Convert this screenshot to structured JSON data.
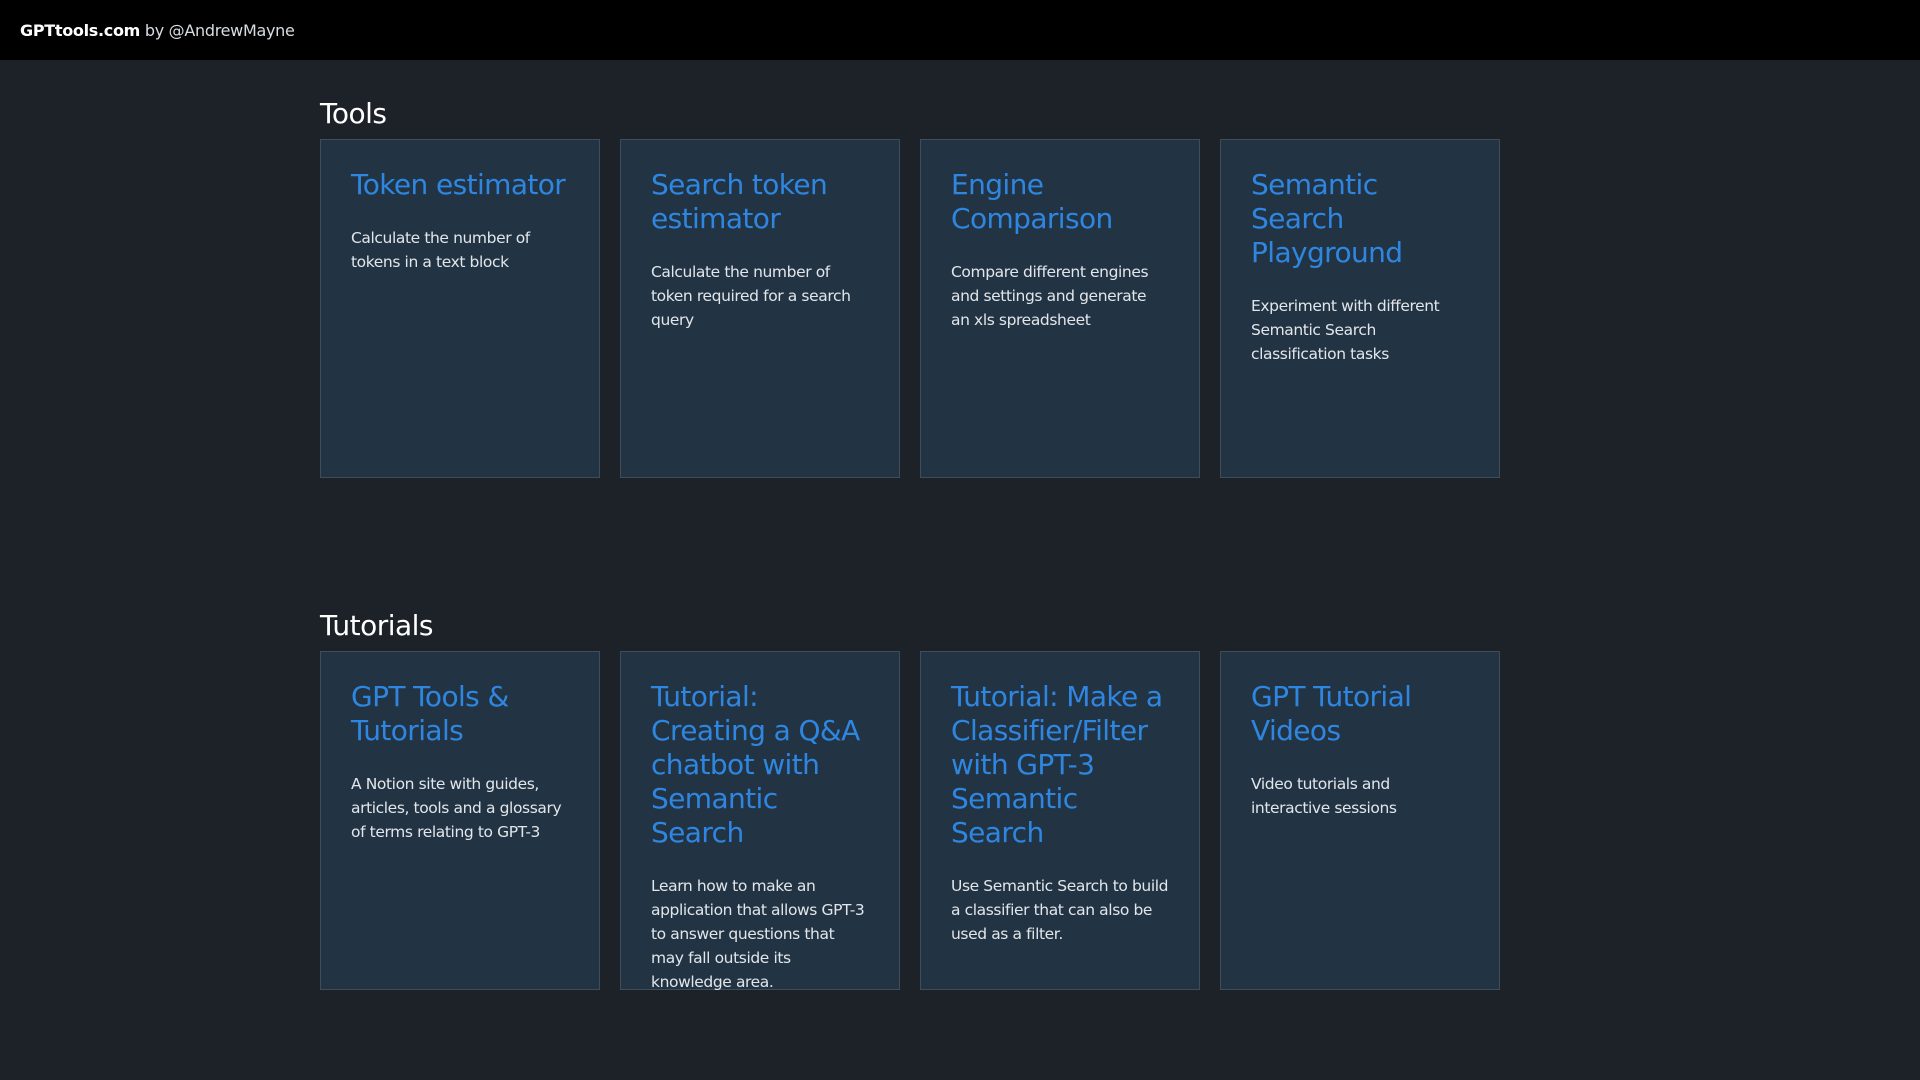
{
  "header": {
    "site": "GPTtools.com",
    "byline": "by @AndrewMayne"
  },
  "tools": {
    "title": "Tools",
    "cards": [
      {
        "title": "Token estimator",
        "description": "Calculate the number of tokens in a text block"
      },
      {
        "title": "Search token estimator",
        "description": "Calculate the number of token required for a search query"
      },
      {
        "title": "Engine Comparison",
        "description": "Compare different engines and settings and generate an xls spreadsheet"
      },
      {
        "title": "Semantic Search Playground",
        "description": "Experiment with different Semantic Search classification tasks"
      }
    ]
  },
  "tutorials": {
    "title": "Tutorials",
    "cards": [
      {
        "title": "GPT Tools & Tutorials",
        "description": "A Notion site with guides, articles, tools and a glossary of terms relating to GPT-3"
      },
      {
        "title": "Tutorial: Creating a Q&A chatbot with Semantic Search",
        "description": "Learn how to make an application that allows GPT-3 to answer questions that may fall outside its knowledge area."
      },
      {
        "title": "Tutorial: Make a Classifier/Filter with GPT-3 Semantic Search",
        "description": "Use Semantic Search to build a classifier that can also be used as a filter."
      },
      {
        "title": "GPT Tutorial Videos",
        "description": "Video tutorials and interactive sessions"
      }
    ]
  },
  "colors": {
    "background": "#1c2228",
    "header_bg": "#000000",
    "card_bg": "#223444",
    "card_border": "#3e4d59",
    "link": "#2f86e0",
    "text": "#e2e6ea"
  }
}
